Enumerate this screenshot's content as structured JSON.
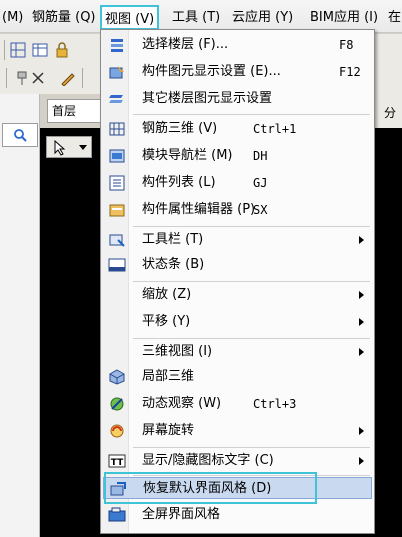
{
  "menubar": {
    "items": [
      {
        "label": "(M)"
      },
      {
        "label": "钢筋量 (Q)"
      },
      {
        "label": "视图 (V)"
      },
      {
        "label": "工具 (T)"
      },
      {
        "label": "云应用 (Y)"
      },
      {
        "label": "BIM应用 (I)"
      },
      {
        "label": "在"
      }
    ]
  },
  "toolbar": {
    "floor_value": "首层",
    "partial_label": "分"
  },
  "view_menu": {
    "items": [
      {
        "label": "选择楼层 (F)...",
        "shortcut": "F8",
        "icon": "floor-select-icon"
      },
      {
        "label": "构件图元显示设置 (E)...",
        "shortcut": "F12",
        "icon": "display-settings-icon"
      },
      {
        "label": "其它楼层图元显示设置",
        "shortcut": "",
        "icon": "other-floor-icon"
      },
      {
        "label": "钢筋三维 (V)",
        "shortcut": "Ctrl+1",
        "icon": "rebar-3d-icon"
      },
      {
        "label": "模块导航栏 (M)",
        "shortcut": "DH",
        "icon": "module-nav-icon"
      },
      {
        "label": "构件列表 (L)",
        "shortcut": "GJ",
        "icon": "component-list-icon"
      },
      {
        "label": "构件属性编辑器 (P)",
        "shortcut": "SX",
        "icon": "property-editor-icon"
      },
      {
        "label": "工具栏 (T)",
        "shortcut": "",
        "icon": "toolbar-icon"
      },
      {
        "label": "状态条 (B)",
        "shortcut": "",
        "icon": "statusbar-icon"
      },
      {
        "label": "缩放 (Z)",
        "shortcut": "",
        "icon": ""
      },
      {
        "label": "平移 (Y)",
        "shortcut": "",
        "icon": ""
      },
      {
        "label": "三维视图 (I)",
        "shortcut": "",
        "icon": ""
      },
      {
        "label": "局部三维",
        "shortcut": "",
        "icon": "local-3d-icon"
      },
      {
        "label": "动态观察 (W)",
        "shortcut": "Ctrl+3",
        "icon": "dynamic-orbit-icon"
      },
      {
        "label": "屏幕旋转",
        "shortcut": "",
        "icon": "screen-rotate-icon"
      },
      {
        "label": "显示/隐藏图标文字 (C)",
        "shortcut": "",
        "icon": "tt-icon"
      },
      {
        "label": "恢复默认界面风格 (D)",
        "shortcut": "",
        "icon": "restore-layout-icon"
      },
      {
        "label": "全屏界面风格",
        "shortcut": "",
        "icon": "fullscreen-icon"
      }
    ]
  },
  "colors": {
    "highlight_border": "#3fc3d6",
    "hover_bg": "#c9d9f0"
  }
}
